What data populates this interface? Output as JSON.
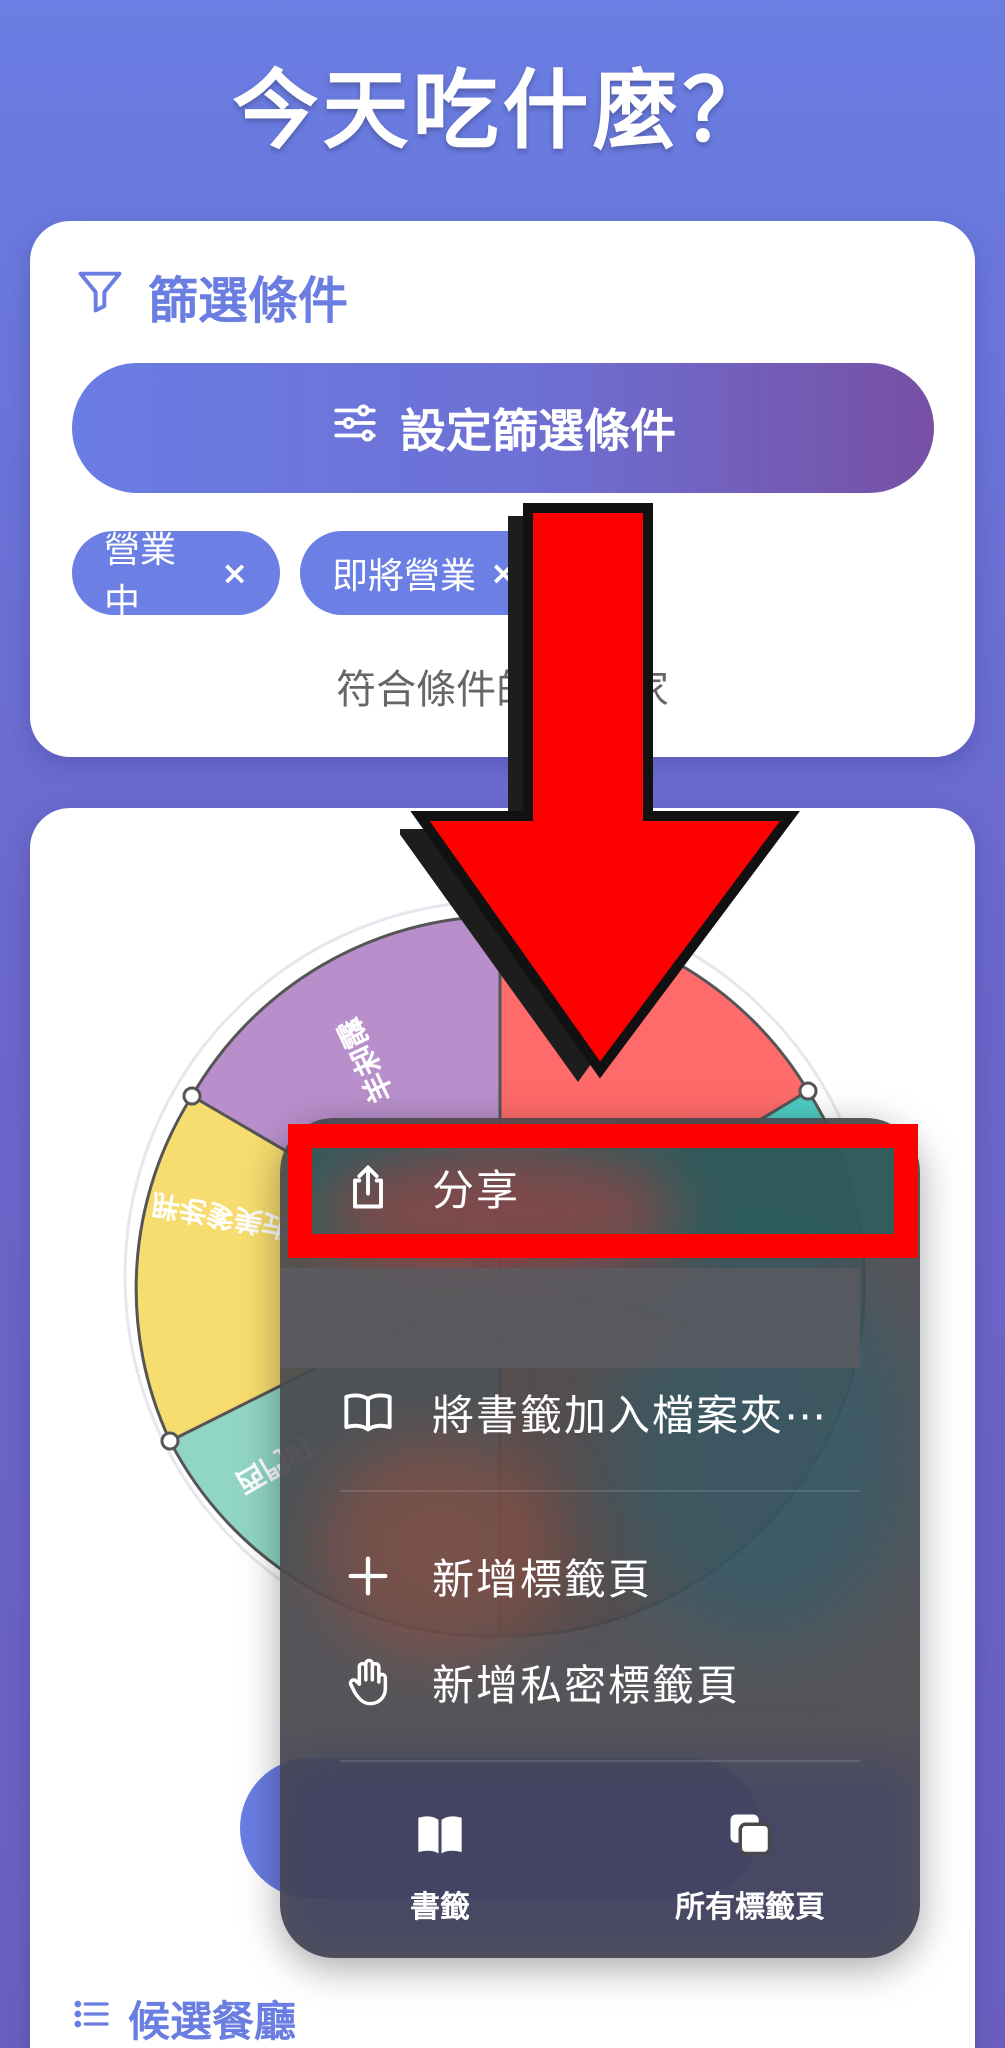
{
  "app": {
    "title": "今天吃什麼？"
  },
  "filter": {
    "header": "篩選條件",
    "set_button_label": "設定篩選條件",
    "chips": [
      {
        "label": "營業中",
        "remove": "×"
      },
      {
        "label": "即將營業",
        "remove": "×"
      }
    ],
    "match_text": "符合條件的餐廳   家"
  },
  "wheel": {
    "segments": [
      {
        "label": "霸味羊",
        "color": "#b88fcb"
      },
      {
        "label": "",
        "color": "#ff6b6b"
      },
      {
        "label": "",
        "color": "#4ecdc4"
      },
      {
        "label": "胖老爹美式炸雞",
        "color": "#f7dc6f"
      },
      {
        "label": "西門町",
        "color": "#91d5c4"
      }
    ]
  },
  "candidates": {
    "label": "候選餐廳"
  },
  "menu": {
    "share": "分享",
    "add_bookmark_folder": "將書籤加入檔案夾⋯",
    "new_tab": "新增標籤頁",
    "new_private_tab": "新增私密標籤頁",
    "bookmarks": "書籤",
    "all_tabs": "所有標籤頁"
  },
  "colors": {
    "accent": "#6a7de4",
    "highlight": "#ff0000"
  }
}
